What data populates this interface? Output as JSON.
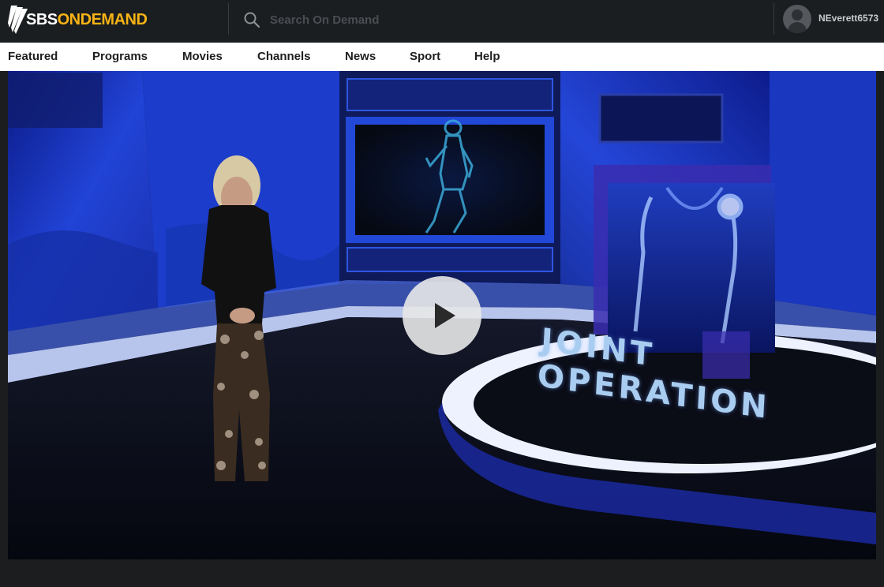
{
  "header": {
    "logo_text_sbs": "SBS",
    "logo_text_ondemand": "ONDEMAND",
    "logo_icon": "sbs-wing-icon",
    "search_placeholder": "Search On Demand",
    "search_icon": "search-icon",
    "username": "NEverett6573"
  },
  "nav": {
    "items": [
      {
        "label": "Featured"
      },
      {
        "label": "Programs"
      },
      {
        "label": "Movies"
      },
      {
        "label": "Channels"
      },
      {
        "label": "News"
      },
      {
        "label": "Sport"
      },
      {
        "label": "Help"
      }
    ]
  },
  "player": {
    "caption_line1": "JOINT",
    "caption_line2": "OPERATION",
    "play_icon": "play-icon"
  },
  "colors": {
    "brand_accent": "#f8b315",
    "header_bg": "#1b1e20",
    "nav_bg": "#ffffff",
    "studio_blue": "#1f3fbf"
  }
}
